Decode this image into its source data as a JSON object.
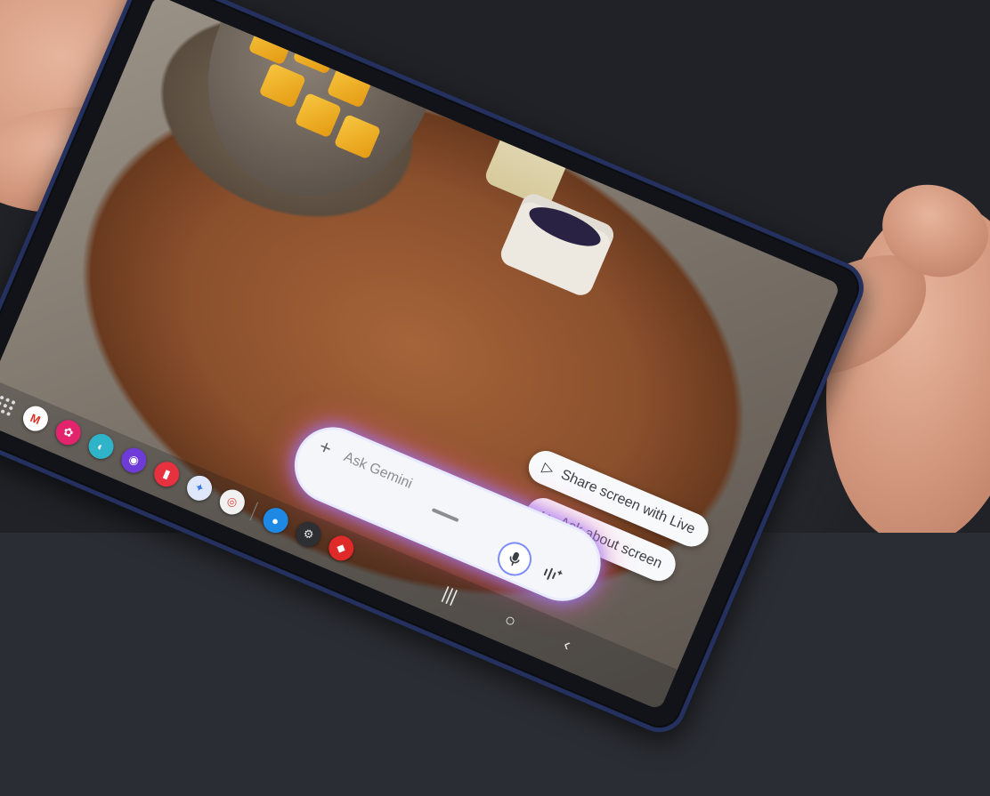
{
  "taskbar": {
    "apps": [
      {
        "name": "gmail-icon",
        "glyph": "M",
        "color": "#ffffff",
        "text": "#d93025"
      },
      {
        "name": "gallery-icon",
        "glyph": "✿",
        "color": "#e2246c",
        "text": "#ffffff"
      },
      {
        "name": "bixby-icon",
        "glyph": "◐",
        "color": "#2fb3c9",
        "text": "#ffffff"
      },
      {
        "name": "internet-icon",
        "glyph": "◉",
        "color": "#6e3bd8",
        "text": "#ffffff"
      },
      {
        "name": "notes-icon",
        "glyph": "▮",
        "color": "#e8313e",
        "text": "#ffffff"
      },
      {
        "name": "gemini-icon",
        "glyph": "✦",
        "color": "#dfe7fb",
        "text": "#3b78e7"
      },
      {
        "name": "chrome-icon",
        "glyph": "◎",
        "color": "#f1f1f1",
        "text": "#db4437"
      },
      {
        "name": "messages-icon",
        "glyph": "●",
        "color": "#1e88e5",
        "text": "#ffffff"
      },
      {
        "name": "settings-icon",
        "glyph": "⚙",
        "color": "#2d2f33",
        "text": "#e6e6e6"
      },
      {
        "name": "screen-recorder-icon",
        "glyph": "◆",
        "color": "#e02a2a",
        "text": "#ffffff"
      }
    ],
    "nav": {
      "recents": "|||",
      "home": "○",
      "back": "‹"
    }
  },
  "gemini": {
    "plus": "+",
    "input_placeholder": "Ask Gemini",
    "chips": {
      "share_screen": {
        "icon": "▷",
        "label": "Share screen with Live"
      },
      "ask_screen": {
        "icon": "↪",
        "label": "Ask about screen"
      }
    }
  }
}
